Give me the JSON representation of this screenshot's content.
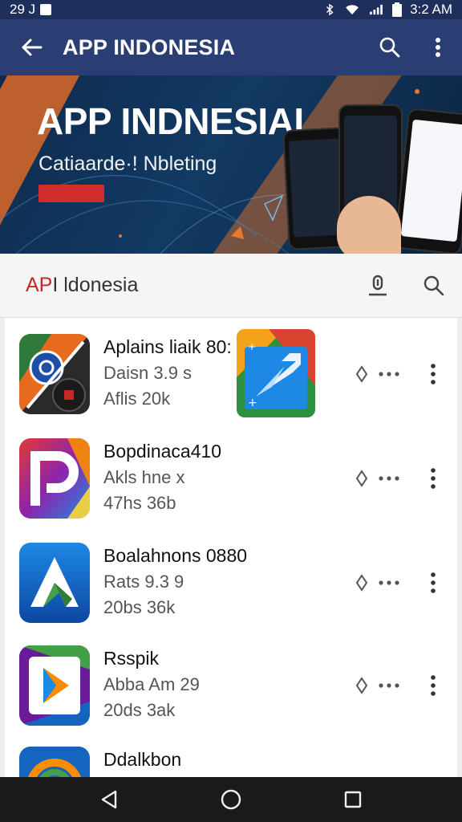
{
  "status_bar": {
    "left_text": "29 J",
    "time": "3:2 AM",
    "icons": [
      "bluetooth-icon",
      "wifi-icon",
      "signal-icon",
      "battery-icon"
    ]
  },
  "app_bar": {
    "title": "APP INDONESIA",
    "icons": [
      "back-arrow-icon",
      "search-icon",
      "more-vert-icon"
    ],
    "color": "#2b3e74"
  },
  "banner": {
    "title": "APP INDNESIAI",
    "subtitle": "Catiaarde·! Nbleting"
  },
  "sub_bar": {
    "brand_prefix": "AP",
    "brand_rest": "I ldonesia",
    "icons": [
      "download-icon",
      "search-icon"
    ]
  },
  "apps": [
    {
      "name": "Aplains liaik  80:",
      "line2": "Daisn 3.9 s",
      "line3": "Aflis 20k"
    },
    {
      "name": "Bopdinaca410",
      "line2": "Akls hne x",
      "line3": "47hs 36b"
    },
    {
      "name": "Boalahnons 0880",
      "line2": "Rats  9.3 9",
      "line3": "20bs  36k"
    },
    {
      "name": "Rsspik",
      "line2": "Abba Am 29",
      "line3": "20ds 3ak"
    },
    {
      "name": "Ddalkbon",
      "line2": "",
      "line3": ""
    }
  ],
  "nav_bar": {
    "icons": [
      "back-triangle-icon",
      "home-circle-icon",
      "recents-square-icon"
    ]
  },
  "colors": {
    "status_bar": "#1f2f5c",
    "accent_red": "#c62828",
    "nav_bar": "#1a1a1a"
  }
}
